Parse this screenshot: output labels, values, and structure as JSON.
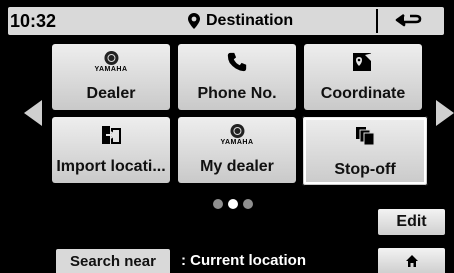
{
  "header": {
    "time": "10:32",
    "title": "Destination",
    "title_icon": "location-pin-icon",
    "back_icon": "return-arrow-icon"
  },
  "tiles": [
    {
      "label": "Dealer",
      "icon": "yamaha-logo-icon",
      "brand": "YAMAHA"
    },
    {
      "label": "Phone No.",
      "icon": "phone-icon"
    },
    {
      "label": "Coordinate",
      "icon": "map-pin-icon"
    },
    {
      "label": "Import locati...",
      "icon": "import-icon"
    },
    {
      "label": "My dealer",
      "icon": "yamaha-logo-icon",
      "brand": "YAMAHA"
    },
    {
      "label": "Stop-off",
      "icon": "stacked-pages-icon",
      "selected": true
    }
  ],
  "pagination": {
    "pages": 3,
    "current": 2
  },
  "edit_label": "Edit",
  "search_near": {
    "label": "Search near",
    "value": ": Current location"
  },
  "home_icon": "home-icon",
  "colors": {
    "background": "#000000",
    "tile": "#dcdcdc",
    "header": "#d9d9d9",
    "dot_inactive": "#8f8f8f",
    "dot_active": "#ffffff"
  }
}
